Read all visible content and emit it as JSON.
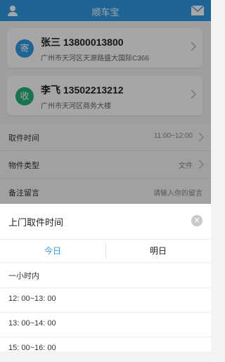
{
  "header": {
    "title": "顺车宝"
  },
  "sender": {
    "badge": "寄",
    "name": "张三 13800013800",
    "address": "广州市天河区天源路盛大国际C366"
  },
  "receiver": {
    "badge": "收",
    "name": "李飞 13502213212",
    "address": "广州市天河区商务大楼"
  },
  "form": [
    {
      "label": "取件时间",
      "value": "11:00~12:00"
    },
    {
      "label": "物件类型",
      "value": "文件"
    },
    {
      "label": "备注留言",
      "placeholder": "请输入你的留言"
    }
  ],
  "sheet": {
    "title": "上门取件时间",
    "tabs": [
      "今日",
      "明日"
    ],
    "active_tab": "今日",
    "slots": [
      "一小时内",
      "12: 00~13: 00",
      "13: 00~14: 00",
      "15: 00~16: 00"
    ]
  },
  "colors": {
    "accent": "#2f9be6",
    "send_badge": "#2f9be6",
    "receive_badge": "#22b37a"
  }
}
